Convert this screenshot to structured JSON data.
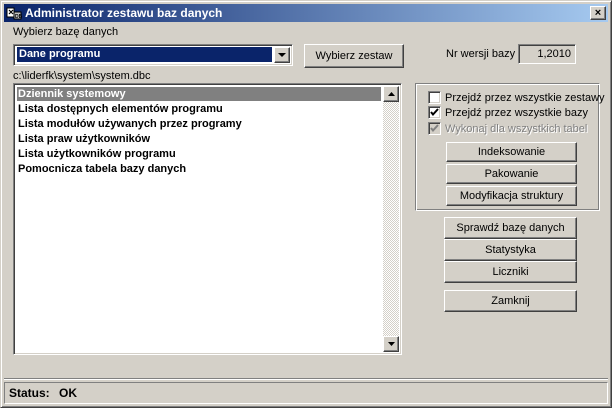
{
  "window": {
    "title": "Administrator zestawu baz danych",
    "close_label": "×"
  },
  "db_select": {
    "label": "Wybierz bazę danych",
    "selected": "Dane programu",
    "choose_button": "Wybierz zestaw"
  },
  "version": {
    "label": "Nr wersji bazy",
    "value": "1,2010"
  },
  "path": "c:\\liderfk\\system\\system.dbc",
  "tables": {
    "items": [
      "Dziennik systemowy",
      "Lista dostępnych elementów programu",
      "Lista modułów używanych przez programy",
      "Lista praw użytkowników",
      "Lista użytkowników programu",
      "Pomocnicza tabela bazy danych"
    ],
    "selected_index": 0
  },
  "options": {
    "all_sets": {
      "label": "Przejdź przez wszystkie zestawy",
      "checked": false,
      "enabled": true
    },
    "all_dbs": {
      "label": "Przejdź przez wszystkie bazy",
      "checked": true,
      "enabled": true
    },
    "all_tables": {
      "label": "Wykonaj dla wszystkich tabel",
      "checked": true,
      "enabled": false
    }
  },
  "actions": {
    "index": "Indeksowanie",
    "pack": "Pakowanie",
    "modify": "Modyfikacja struktury",
    "check": "Sprawdź bazę danych",
    "stats": "Statystyka",
    "counters": "Liczniki",
    "close": "Zamknij"
  },
  "status": {
    "label": "Status:",
    "value": "OK"
  }
}
